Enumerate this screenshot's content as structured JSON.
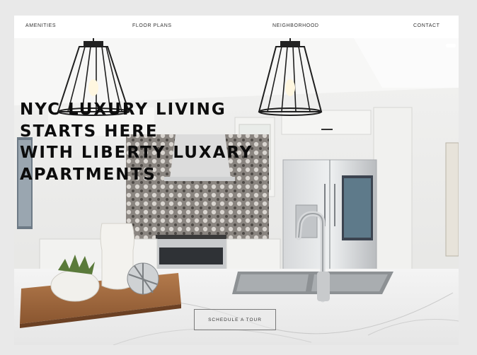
{
  "nav": {
    "items": [
      "AMENITIES",
      "FLOOR PLANS",
      "NEIGHBORHOOD",
      "CONTACT"
    ]
  },
  "hero": {
    "headline_lines": [
      "NYC LUXURY LIVING",
      "STARTS HERE",
      "WITH LIBERTY LUXARY",
      "APARTMENTS"
    ],
    "cta_label": "SCHEDULE A TOUR"
  },
  "colors": {
    "page_background": "#e9e9e9",
    "nav_background": "#ffffff",
    "headline_text": "#0c0c0c"
  }
}
